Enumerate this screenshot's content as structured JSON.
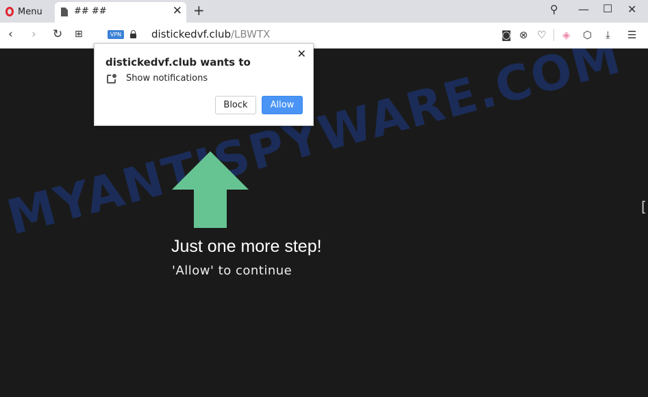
{
  "browser": {
    "menu_label": "Menu",
    "tab_title": "## ##",
    "url_domain": "distickedvf.club",
    "url_path": "/LBWTX",
    "vpn_label": "VPN"
  },
  "page": {
    "heading": "Just one more step!",
    "subtext": "'Allow' to continue",
    "watermark": "MYANTISPYWARE.COM",
    "arrow_color": "#66c492",
    "background": "#1a1a1a"
  },
  "popup": {
    "title": "distickedvf.club wants to",
    "permission": "Show notifications",
    "block_label": "Block",
    "allow_label": "Allow",
    "allow_color": "#4a94f5"
  },
  "icons": [
    "opera-icon",
    "document-icon",
    "close-icon",
    "plus-icon",
    "search-icon",
    "minimize-icon",
    "maximize-icon",
    "back-icon",
    "forward-icon",
    "reload-icon",
    "grid-icon",
    "lock-icon",
    "camera-icon",
    "ad-block-icon",
    "heart-icon",
    "cube-icon",
    "download-icon",
    "settings-icon",
    "notification-icon"
  ]
}
